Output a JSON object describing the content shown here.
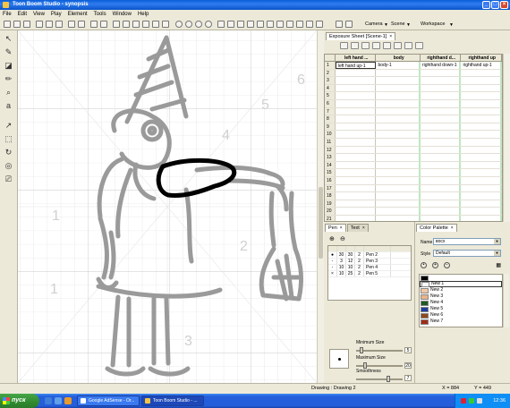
{
  "window": {
    "title": "Toon Boom Studio - synopsis"
  },
  "menu": [
    "File",
    "Edit",
    "View",
    "Play",
    "Element",
    "Tools",
    "Window",
    "Help"
  ],
  "toolbar": {
    "camera": "Camera",
    "scene": "Scene",
    "workspace": "Workspace"
  },
  "exposure_sheet": {
    "tab": "Exposure Sheet [Scene-1]",
    "columns": [
      "left hand ...",
      "body",
      "righthand d...",
      "righthand up"
    ],
    "first_row": [
      "left hand up-1",
      "body-1",
      "righthand down-1",
      "righthand up-1"
    ],
    "row_numbers": [
      "1",
      "2",
      "3",
      "4",
      "5",
      "6",
      "7",
      "8",
      "9",
      "10",
      "11",
      "12",
      "13",
      "14",
      "15",
      "16",
      "17",
      "18",
      "19",
      "20",
      "21"
    ]
  },
  "pen_panel": {
    "tabs": [
      "Pen",
      "Text"
    ],
    "pens": [
      {
        "mark": "●",
        "a": "30",
        "b": "30",
        "c": "2",
        "name": "Pen 2"
      },
      {
        "mark": "-",
        "a": "3",
        "b": "12",
        "c": "2",
        "name": "Pen 3"
      },
      {
        "mark": "-",
        "a": "10",
        "b": "10",
        "c": "2",
        "name": "Pen 4"
      },
      {
        "mark": "×",
        "a": "10",
        "b": "25",
        "c": "2",
        "name": "Pen 5"
      }
    ],
    "minimum_size_label": "Minimum Size",
    "minimum_size": "5",
    "maximum_size_label": "Maximum Size",
    "maximum_size": "20",
    "smoothness_label": "Smoothness",
    "smoothness": "7"
  },
  "color_palette": {
    "tab": "Color Palette",
    "name_label": "Name",
    "name_value": "восх",
    "style_label": "Style",
    "style_value": "Default",
    "colors": [
      {
        "name": "",
        "color": "#000000"
      },
      {
        "name": "New 1",
        "color": "#ffffff"
      },
      {
        "name": "New 2",
        "color": "#f2c9a6"
      },
      {
        "name": "New 3",
        "color": "#e8b48a"
      },
      {
        "name": "New 4",
        "color": "#1f5a23"
      },
      {
        "name": "New 5",
        "color": "#1e3f9a"
      },
      {
        "name": "New 6",
        "color": "#8a4a1e"
      },
      {
        "name": "New 7",
        "color": "#a12a18"
      }
    ]
  },
  "status": {
    "drawing": "Drawing : Drawing 2",
    "x": "X = 884",
    "y": "Y = 449"
  },
  "taskbar": {
    "start": "пуск",
    "tasks": [
      "Google AdSense - Or...",
      "Toon Boom Studio - ..."
    ],
    "clock": "12:36"
  },
  "colors": {
    "accent": "#245edb",
    "stroke_gray": "#9a9a9a"
  }
}
